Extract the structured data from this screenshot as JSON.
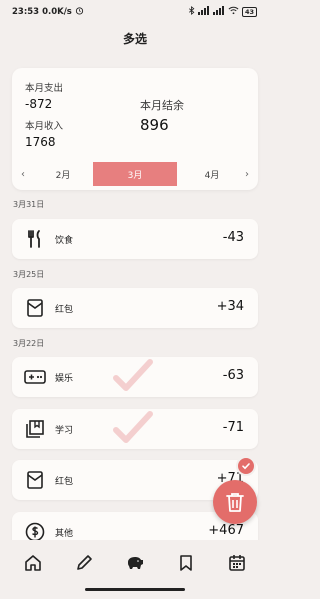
{
  "status": {
    "time": "23:53",
    "speed": "0.0K/s",
    "battery": "43"
  },
  "header": {
    "title": "多选"
  },
  "summary": {
    "expense_label": "本月支出",
    "expense_value": "-872",
    "income_label": "本月收入",
    "income_value": "1768",
    "balance_label": "本月结余",
    "balance_value": "896"
  },
  "months": {
    "prev": "2月",
    "current": "3月",
    "next": "4月"
  },
  "groups": [
    {
      "date": "3月31日",
      "items": [
        {
          "category": "饮食",
          "amount": "-43",
          "icon": "fork-knife-icon"
        }
      ]
    },
    {
      "date": "3月25日",
      "items": [
        {
          "category": "红包",
          "amount": "+34",
          "icon": "red-envelope-icon"
        }
      ]
    },
    {
      "date": "3月22日",
      "items": [
        {
          "category": "娱乐",
          "amount": "-63",
          "icon": "gamepad-icon"
        },
        {
          "category": "学习",
          "amount": "-71",
          "icon": "book-icon"
        },
        {
          "category": "红包",
          "amount": "+71",
          "icon": "red-envelope-icon"
        },
        {
          "category": "其他",
          "amount": "+467",
          "icon": "dollar-icon"
        }
      ]
    }
  ],
  "colors": {
    "accent": "#e36d6a",
    "active_tab": "#e77f7f",
    "background": "#f3efed",
    "card": "#fdfbf9"
  }
}
